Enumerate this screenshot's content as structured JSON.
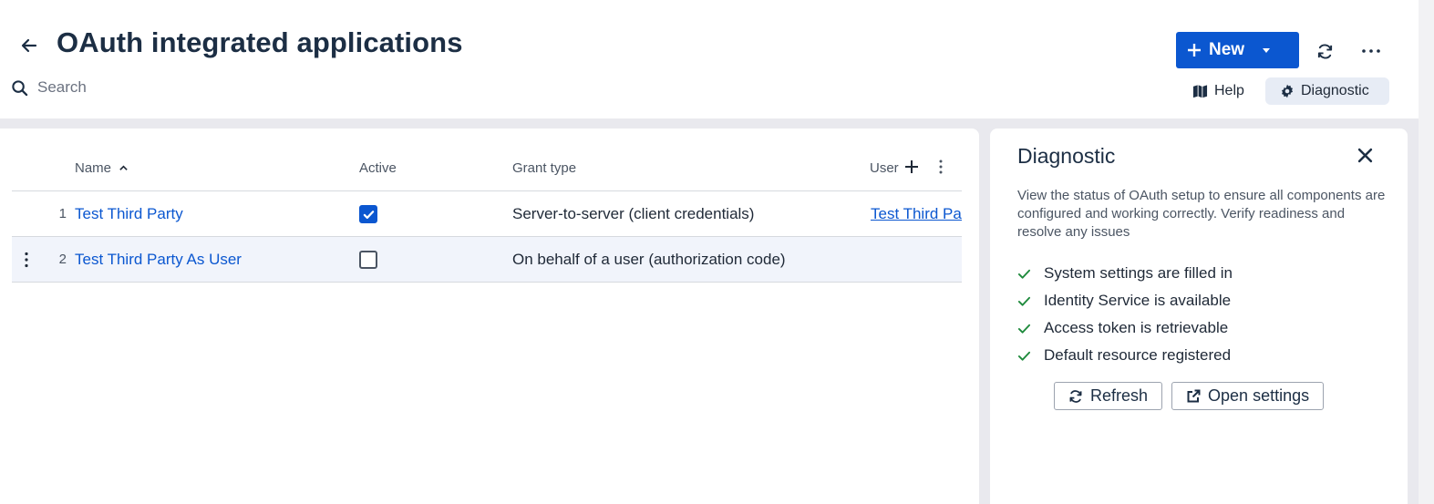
{
  "header": {
    "title": "OAuth integrated applications",
    "new_label": "New",
    "search_placeholder": "Search",
    "help_label": "Help",
    "diagnostic_label": "Diagnostic"
  },
  "table": {
    "columns": {
      "name": "Name",
      "active": "Active",
      "grant_type": "Grant type",
      "user": "User"
    },
    "sort": {
      "column": "Name",
      "direction": "ascending"
    },
    "rows": [
      {
        "num": "1",
        "name": "Test Third Party",
        "active": true,
        "grant_type": "Server-to-server (client credentials)",
        "user": "Test Third Party"
      },
      {
        "num": "2",
        "name": "Test Third Party As User",
        "active": false,
        "grant_type": "On behalf of a user (authorization code)",
        "user": ""
      }
    ]
  },
  "diagnostic": {
    "title": "Diagnostic",
    "description": "View the status of OAuth setup to ensure all components are configured and working correctly. Verify readiness and resolve any issues",
    "checks": [
      "System settings are filled in",
      "Identity Service is available",
      "Access token is retrievable",
      "Default resource registered"
    ],
    "refresh_label": "Refresh",
    "open_settings_label": "Open settings"
  },
  "colors": {
    "primary": "#0b57d0",
    "title": "#1c2e44",
    "success": "#1e8a3c",
    "panel_bg": "#e9e9ee",
    "selected_button_bg": "#e7ecf5"
  },
  "icons": [
    "settings-small-icon",
    "expand-icon",
    "back-arrow-icon",
    "plus-icon",
    "caret-down-icon",
    "refresh-icon",
    "more-horizontal-icon",
    "search-icon",
    "book-icon",
    "gear-icon",
    "sort-up-icon",
    "add-column-icon",
    "more-vertical-icon",
    "checkmark-icon",
    "close-icon",
    "external-link-icon"
  ]
}
